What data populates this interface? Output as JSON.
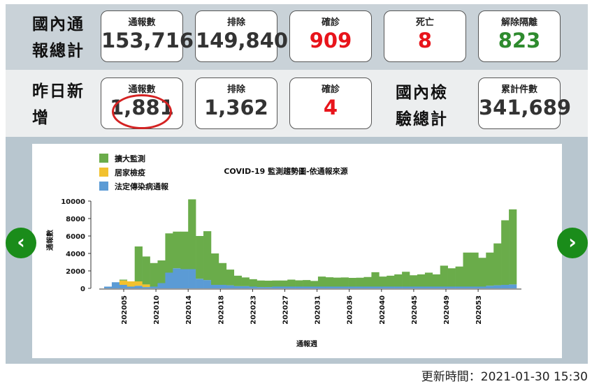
{
  "domestic_total": {
    "title_line1": "國內通",
    "title_line2": "報總計",
    "cards": [
      {
        "label": "通報數",
        "value": "153,716"
      },
      {
        "label": "排除",
        "value": "149,840"
      },
      {
        "label": "確診",
        "value": "909"
      },
      {
        "label": "死亡",
        "value": "8"
      },
      {
        "label": "解除隔離",
        "value": "823"
      }
    ]
  },
  "yesterday_new": {
    "title_line1": "昨日新",
    "title_line2": "增",
    "cards": [
      {
        "label": "通報數",
        "value": "1,881"
      },
      {
        "label": "排除",
        "value": "1,362"
      },
      {
        "label": "確診",
        "value": "4"
      }
    ]
  },
  "test_total": {
    "title_line1": "國內檢",
    "title_line2": "驗總計",
    "card": {
      "label": "累計件數",
      "value": "341,689"
    }
  },
  "nav": {
    "prev_icon": "chevron-left-icon",
    "next_icon": "chevron-right-icon"
  },
  "updated_text": "更新時間：2021-01-30 15:30",
  "colors": {
    "green_series": "#6aac4a",
    "yellow_series": "#f2c12e",
    "blue_series": "#5b9bd5",
    "accent_green": "#1a8c1a",
    "red": "#e8141b"
  },
  "chart_data": {
    "type": "bar",
    "stacked": true,
    "title": "COVID-19 監測趨勢圖-依通報來源",
    "xlabel": "通報週",
    "ylabel": "通報數",
    "ylim": [
      0,
      10000
    ],
    "yticks": [
      "0",
      "2000",
      "4000",
      "6000",
      "8000",
      "10000"
    ],
    "xtick_labels": [
      "202005",
      "202010",
      "202014",
      "202018",
      "202023",
      "202027",
      "202031",
      "202036",
      "202040",
      "202045",
      "202049",
      "202053"
    ],
    "legend_position": "top-left",
    "series": [
      {
        "name": "擴大監測",
        "color": "#6aac4a",
        "values": [
          0,
          0,
          100,
          0,
          4000,
          3200,
          2700,
          2600,
          4500,
          4200,
          4300,
          8000,
          4900,
          5600,
          3600,
          2500,
          1800,
          1200,
          1000,
          850,
          750,
          730,
          700,
          700,
          800,
          720,
          750,
          650,
          1150,
          1070,
          1030,
          1050,
          1000,
          1020,
          1100,
          1650,
          1150,
          1250,
          1400,
          1700,
          1300,
          1400,
          1600,
          1400,
          2400,
          2100,
          2300,
          3900,
          3900,
          3300,
          3800,
          4800,
          7400,
          8600
        ]
      },
      {
        "name": "居家檢疫",
        "color": "#f2c12e",
        "values": [
          0,
          0,
          500,
          600,
          500,
          300,
          0,
          0,
          0,
          0,
          0,
          0,
          0,
          0,
          0,
          0,
          0,
          0,
          0,
          0,
          0,
          0,
          0,
          0,
          0,
          0,
          0,
          0,
          0,
          0,
          0,
          0,
          0,
          0,
          0,
          0,
          0,
          0,
          0,
          0,
          0,
          0,
          0,
          0,
          0,
          0,
          0,
          0,
          0,
          0,
          0,
          0,
          0,
          0
        ]
      },
      {
        "name": "法定傳染病通報",
        "color": "#5b9bd5",
        "values": [
          200,
          700,
          400,
          200,
          300,
          150,
          200,
          600,
          1800,
          2300,
          2200,
          2200,
          1100,
          950,
          400,
          400,
          350,
          250,
          250,
          200,
          150,
          150,
          200,
          200,
          200,
          200,
          200,
          200,
          200,
          200,
          200,
          200,
          200,
          200,
          200,
          200,
          200,
          200,
          200,
          200,
          200,
          200,
          200,
          200,
          200,
          200,
          200,
          200,
          200,
          200,
          300,
          350,
          400,
          450
        ]
      }
    ]
  }
}
